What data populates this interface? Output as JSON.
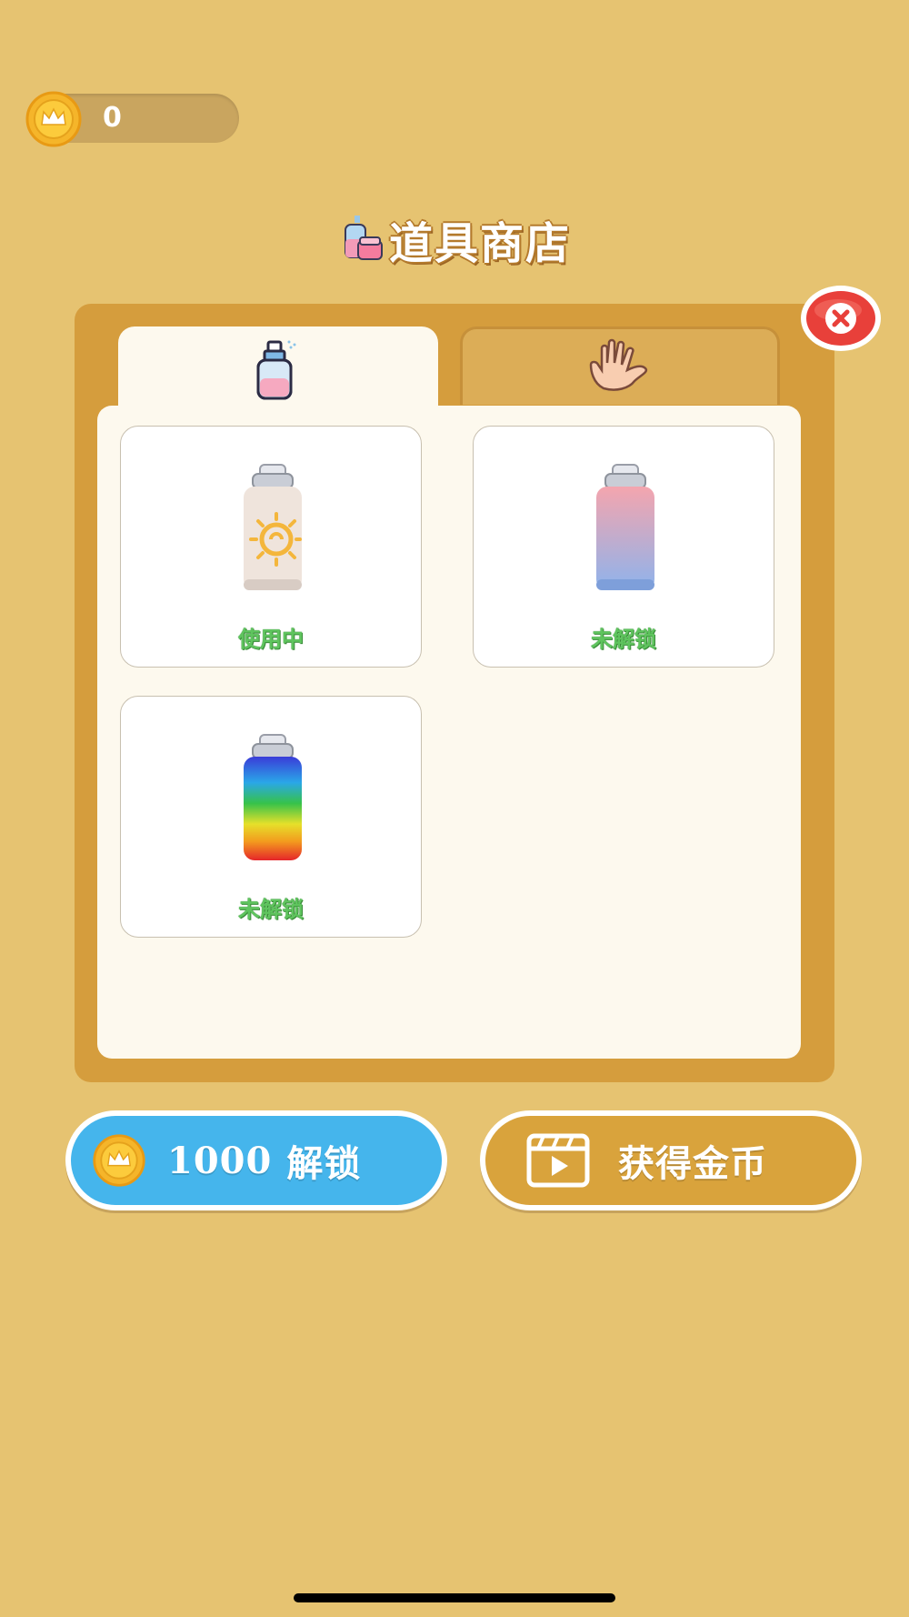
{
  "coin_counter": {
    "value": "0"
  },
  "title": "道具商店",
  "tabs": [
    {
      "icon": "spray-bottle-icon",
      "active": true
    },
    {
      "icon": "hand-icon",
      "active": false
    }
  ],
  "items": [
    {
      "name": "sun-swirl-spray-can",
      "status": "使用中"
    },
    {
      "name": "pink-blue-spray-can",
      "status": "未解锁"
    },
    {
      "name": "rainbow-spray-can",
      "status": "未解锁"
    }
  ],
  "buttons": {
    "unlock": {
      "price": "1000",
      "label": "解锁"
    },
    "get_coins": {
      "label": "获得金币",
      "icon": "video-clapper-icon"
    }
  },
  "colors": {
    "background": "#E6C371",
    "panel": "#D59D3D",
    "inner": "#FDF9EE",
    "unlock_button": "#45B5EC",
    "coins_button": "#D9A33C",
    "status_text": "#5FC45E",
    "close_button": "#E8403A"
  }
}
